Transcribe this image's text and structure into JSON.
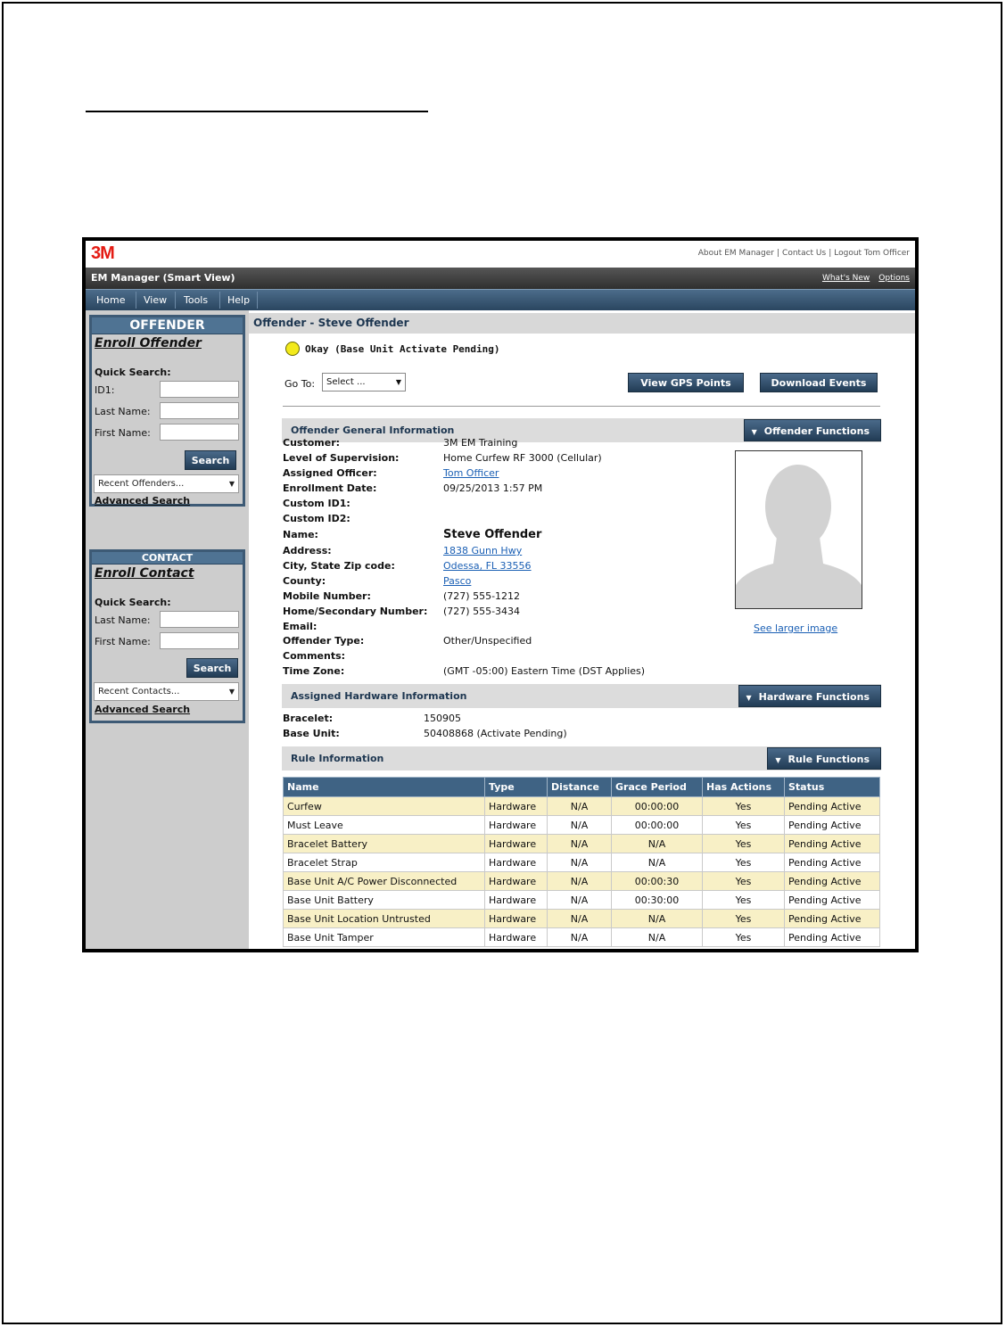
{
  "topbar": {
    "logo": "3M",
    "links": [
      "About EM Manager",
      "Contact Us",
      "Logout Tom Officer"
    ]
  },
  "titlebar": {
    "title": "EM Manager (Smart View)",
    "whats_new": "What's New",
    "options": "Options"
  },
  "menu": [
    "Home",
    "View",
    "Tools",
    "Help"
  ],
  "offender_panel": {
    "heading": "OFFENDER",
    "enroll": "Enroll Offender",
    "quick_search": "Quick Search:",
    "fields": [
      "ID1:",
      "Last Name:",
      "First Name:"
    ],
    "search_button": "Search",
    "recent": "Recent Offenders...",
    "advanced": "Advanced Search"
  },
  "contact_panel": {
    "heading": "CONTACT",
    "enroll": "Enroll Contact",
    "quick_search": "Quick Search:",
    "fields": [
      "Last Name:",
      "First Name:"
    ],
    "search_button": "Search",
    "recent": "Recent Contacts...",
    "advanced": "Advanced Search"
  },
  "page": {
    "title": "Offender - Steve Offender",
    "status": "Okay (Base Unit Activate Pending)",
    "status_color": "#f3ea1b",
    "goto_label": "Go To:",
    "goto_value": "Select ...",
    "view_gps": "View GPS Points",
    "download_events": "Download Events"
  },
  "general": {
    "title": "Offender General Information",
    "functions": "Offender Functions",
    "rows": [
      {
        "k": "Customer:",
        "v": "3M EM Training"
      },
      {
        "k": "Level of Supervision:",
        "v": "Home Curfew RF 3000 (Cellular)"
      },
      {
        "k": "Assigned Officer:",
        "v": "Tom Officer"
      },
      {
        "k": "Enrollment Date:",
        "v": "09/25/2013 1:57 PM"
      },
      {
        "k": "Custom ID1:",
        "v": ""
      },
      {
        "k": "Custom ID2:",
        "v": ""
      },
      {
        "k": "Name:",
        "v": "Steve Offender"
      },
      {
        "k": "Address:",
        "v": "1838 Gunn Hwy"
      },
      {
        "k": "City, State Zip code:",
        "v": "Odessa, FL 33556"
      },
      {
        "k": "County:",
        "v": "Pasco"
      },
      {
        "k": "Mobile Number:",
        "v": "(727) 555-1212"
      },
      {
        "k": "Home/Secondary Number:",
        "v": "(727) 555-3434"
      },
      {
        "k": "Email:",
        "v": ""
      },
      {
        "k": "Offender Type:",
        "v": "Other/Unspecified"
      },
      {
        "k": "Comments:",
        "v": ""
      },
      {
        "k": "Time Zone:",
        "v": "(GMT -05:00) Eastern Time (DST Applies)"
      }
    ],
    "see_larger": "See larger image"
  },
  "hardware": {
    "title": "Assigned Hardware Information",
    "functions": "Hardware Functions",
    "rows": [
      {
        "k": "Bracelet:",
        "v": "150905"
      },
      {
        "k": "Base Unit:",
        "v": "50408868 (Activate Pending)"
      }
    ]
  },
  "rules": {
    "title": "Rule Information",
    "functions": "Rule Functions",
    "columns": [
      "Name",
      "Type",
      "Distance",
      "Grace Period",
      "Has Actions",
      "Status"
    ],
    "rows": [
      [
        "Curfew",
        "Hardware",
        "N/A",
        "00:00:00",
        "Yes",
        "Pending Active"
      ],
      [
        "Must Leave",
        "Hardware",
        "N/A",
        "00:00:00",
        "Yes",
        "Pending Active"
      ],
      [
        "Bracelet Battery",
        "Hardware",
        "N/A",
        "N/A",
        "Yes",
        "Pending Active"
      ],
      [
        "Bracelet Strap",
        "Hardware",
        "N/A",
        "N/A",
        "Yes",
        "Pending Active"
      ],
      [
        "Base Unit A/C Power Disconnected",
        "Hardware",
        "N/A",
        "00:00:30",
        "Yes",
        "Pending Active"
      ],
      [
        "Base Unit Battery",
        "Hardware",
        "N/A",
        "00:30:00",
        "Yes",
        "Pending Active"
      ],
      [
        "Base Unit Location Untrusted",
        "Hardware",
        "N/A",
        "N/A",
        "Yes",
        "Pending Active"
      ],
      [
        "Base Unit Tamper",
        "Hardware",
        "N/A",
        "N/A",
        "Yes",
        "Pending Active"
      ]
    ]
  }
}
